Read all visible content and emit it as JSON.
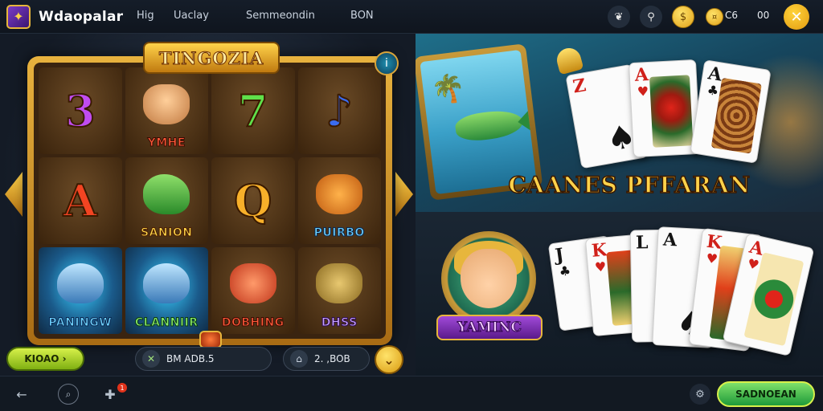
{
  "header": {
    "app_title": "Wdaopalar",
    "nav": [
      "Hig",
      "Uaclay",
      "Semmeondin",
      "BON"
    ],
    "coins_label": "C6",
    "counter": "00",
    "logo_glyph": "✦",
    "close_glyph": "✕"
  },
  "slot": {
    "title": "TINGOZIA",
    "cells": [
      {
        "glyph": "3",
        "label": ""
      },
      {
        "glyph": "",
        "label": "YMHE"
      },
      {
        "glyph": "7",
        "label": ""
      },
      {
        "glyph": "♪",
        "label": ""
      },
      {
        "glyph": "A",
        "label": ""
      },
      {
        "glyph": "",
        "label": "SANION"
      },
      {
        "glyph": "Q",
        "label": ""
      },
      {
        "glyph": "",
        "label": "PUIRBO"
      },
      {
        "glyph": "",
        "label": "PANINGW"
      },
      {
        "glyph": "",
        "label": "CLANNIIR"
      },
      {
        "glyph": "",
        "label": "DOBHING"
      },
      {
        "glyph": "",
        "label": "DHSS"
      }
    ],
    "bet_button": "KIOAO ›",
    "balance": "BM ADB.5",
    "bet_value": "2. ,BOB",
    "info_glyph": "i"
  },
  "promo_top": {
    "title": "CAANES PFFARAN",
    "cards": [
      {
        "rank": "Z",
        "suit": "♠",
        "color": "red"
      },
      {
        "rank": "A",
        "suit": "♥",
        "color": "red"
      },
      {
        "rank": "A",
        "suit": "♣",
        "color": "black"
      }
    ]
  },
  "promo_bottom": {
    "medal_label": "YAMINC",
    "cards": [
      {
        "rank": "J",
        "suit": "♣",
        "color": "black"
      },
      {
        "rank": "K",
        "suit": "♥",
        "color": "red"
      },
      {
        "rank": "L",
        "suit": "♣",
        "color": "black"
      },
      {
        "rank": "A",
        "suit": "♠",
        "color": "black"
      },
      {
        "rank": "K",
        "suit": "♥",
        "color": "red"
      },
      {
        "rank": "A",
        "suit": "♥",
        "color": "red"
      }
    ]
  },
  "footer": {
    "cta": "SADNOEAN",
    "badge": "1"
  },
  "colors": {
    "gold": "#e7b63c",
    "green_cta": "#1e9a3a",
    "panel_bg": "#141b26"
  }
}
